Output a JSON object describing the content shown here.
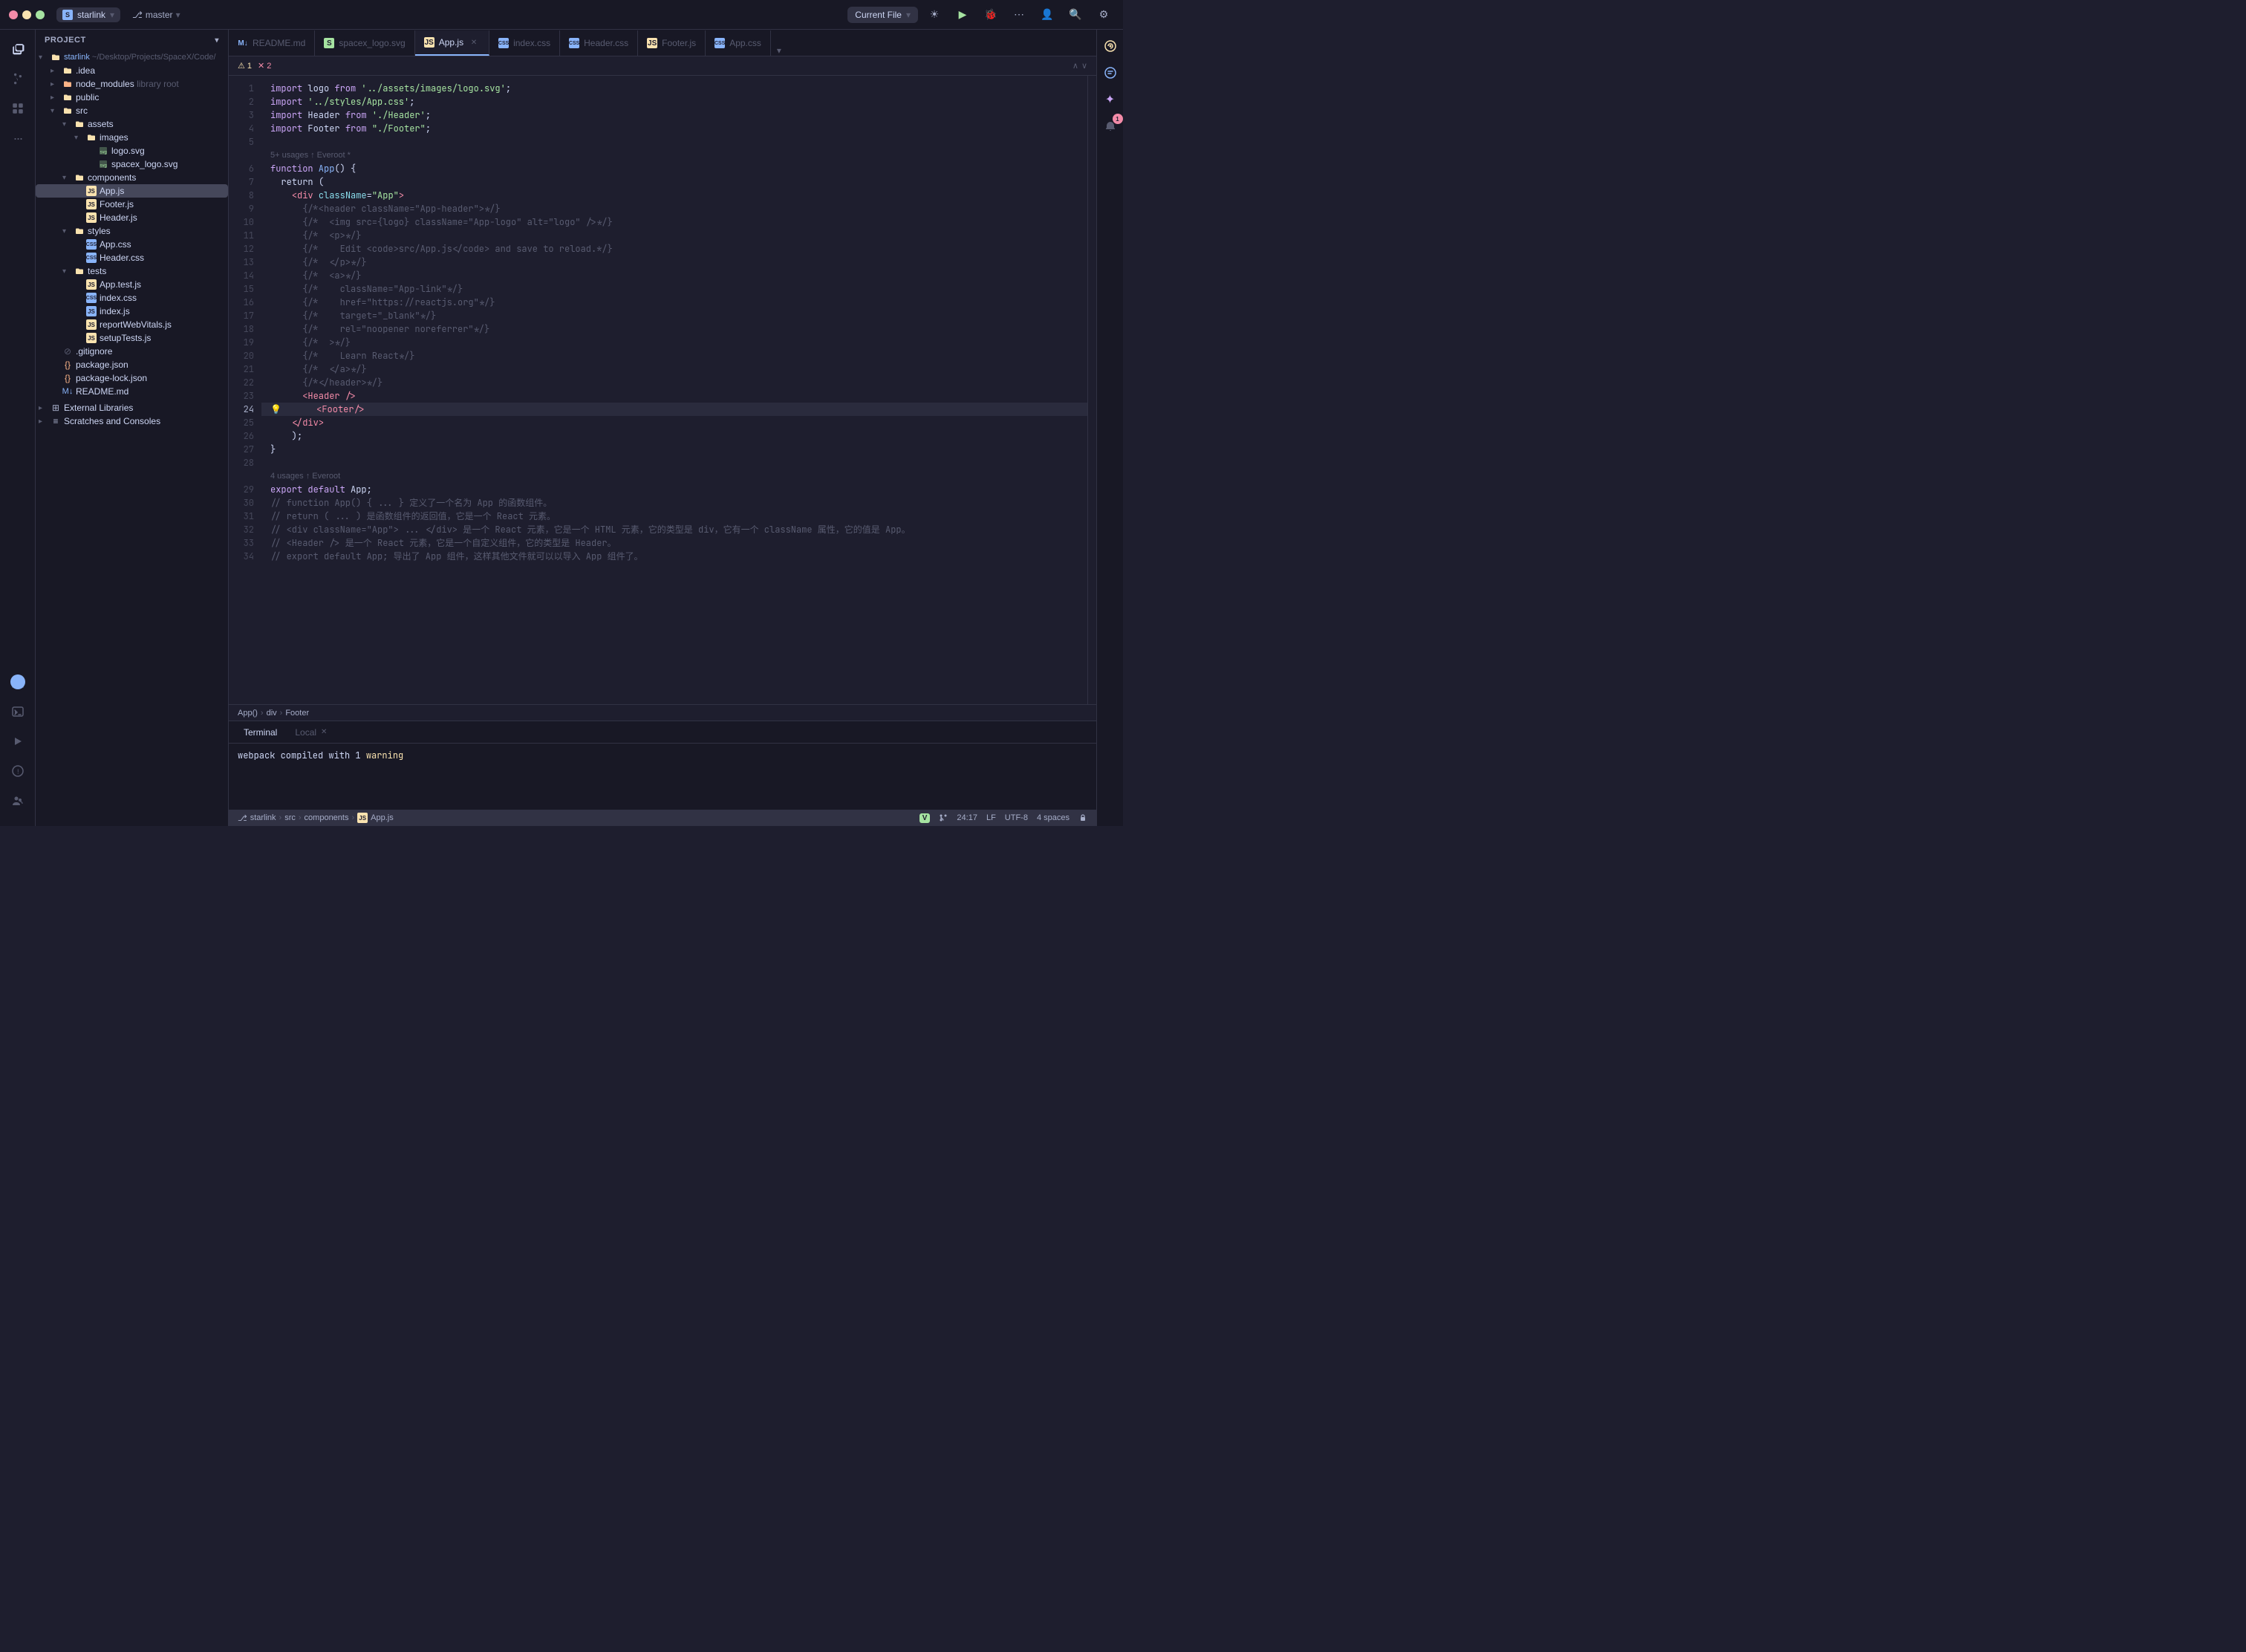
{
  "titlebar": {
    "project_icon": "S",
    "project_name": "starlink",
    "branch_icon": "⎇",
    "branch_name": "master",
    "current_file_label": "Current File",
    "run_icon": "▶",
    "debug_icon": "🐞",
    "more_icon": "⋯",
    "account_icon": "👤",
    "search_icon": "🔍",
    "settings_icon": "⚙"
  },
  "activity_bar": {
    "icons": [
      {
        "name": "files-icon",
        "glyph": "📄",
        "active": true
      },
      {
        "name": "git-icon",
        "glyph": "⎇",
        "active": false
      },
      {
        "name": "extensions-icon",
        "glyph": "⊞",
        "active": false
      },
      {
        "name": "more-icon",
        "glyph": "···",
        "active": false
      }
    ],
    "bottom_icons": [
      {
        "name": "avatar-icon",
        "glyph": "👤"
      },
      {
        "name": "terminal-icon",
        "glyph": "⬜"
      },
      {
        "name": "run-icon",
        "glyph": "▷"
      },
      {
        "name": "problems-icon",
        "glyph": "⚠"
      },
      {
        "name": "collab-icon",
        "glyph": "👥"
      }
    ]
  },
  "sidebar": {
    "header": "Project",
    "tree": [
      {
        "id": "starlink-root",
        "label": "starlink ~/Desktop/Projects/SpaceX/Code/",
        "type": "root",
        "expanded": true,
        "depth": 0
      },
      {
        "id": "idea",
        "label": ".idea",
        "type": "folder",
        "expanded": false,
        "depth": 1
      },
      {
        "id": "node_modules",
        "label": "node_modules",
        "sublabel": "library root",
        "type": "folder-special",
        "expanded": false,
        "depth": 1
      },
      {
        "id": "public",
        "label": "public",
        "type": "folder",
        "expanded": false,
        "depth": 1
      },
      {
        "id": "src",
        "label": "src",
        "type": "folder",
        "expanded": true,
        "depth": 1
      },
      {
        "id": "assets",
        "label": "assets",
        "type": "folder",
        "expanded": true,
        "depth": 2
      },
      {
        "id": "images",
        "label": "images",
        "type": "folder",
        "expanded": true,
        "depth": 3
      },
      {
        "id": "logo-svg",
        "label": "logo.svg",
        "type": "svg",
        "depth": 4
      },
      {
        "id": "spacex-svg",
        "label": "spacex_logo.svg",
        "type": "svg",
        "depth": 4
      },
      {
        "id": "components",
        "label": "components",
        "type": "folder",
        "expanded": true,
        "depth": 2
      },
      {
        "id": "app-js",
        "label": "App.js",
        "type": "js",
        "depth": 3,
        "active": true
      },
      {
        "id": "footer-js",
        "label": "Footer.js",
        "type": "js",
        "depth": 3
      },
      {
        "id": "header-js",
        "label": "Header.js",
        "type": "js",
        "depth": 3
      },
      {
        "id": "styles",
        "label": "styles",
        "type": "folder",
        "expanded": true,
        "depth": 2
      },
      {
        "id": "app-css",
        "label": "App.css",
        "type": "css",
        "depth": 3
      },
      {
        "id": "header-css",
        "label": "Header.css",
        "type": "css",
        "depth": 3
      },
      {
        "id": "tests",
        "label": "tests",
        "type": "folder",
        "expanded": true,
        "depth": 2
      },
      {
        "id": "app-test",
        "label": "App.test.js",
        "type": "test",
        "depth": 3
      },
      {
        "id": "index-css",
        "label": "index.css",
        "type": "css",
        "depth": 3
      },
      {
        "id": "index-js",
        "label": "index.js",
        "type": "js",
        "depth": 3
      },
      {
        "id": "reportweb",
        "label": "reportWebVitals.js",
        "type": "js",
        "depth": 3
      },
      {
        "id": "setuptests",
        "label": "setupTests.js",
        "type": "js",
        "depth": 3
      },
      {
        "id": "gitignore",
        "label": ".gitignore",
        "type": "git",
        "depth": 1
      },
      {
        "id": "package-json",
        "label": "package.json",
        "type": "json",
        "depth": 1
      },
      {
        "id": "package-lock",
        "label": "package-lock.json",
        "type": "json",
        "depth": 1
      },
      {
        "id": "readme",
        "label": "README.md",
        "type": "md",
        "depth": 1
      },
      {
        "id": "ext-libs",
        "label": "External Libraries",
        "type": "folder",
        "expanded": false,
        "depth": 0
      },
      {
        "id": "scratches",
        "label": "Scratches and Consoles",
        "type": "folder",
        "expanded": false,
        "depth": 0
      }
    ]
  },
  "tabs": [
    {
      "id": "readme-tab",
      "label": "README.md",
      "type": "md",
      "active": false
    },
    {
      "id": "spacex-svg-tab",
      "label": "spacex_logo.svg",
      "type": "svg",
      "active": false
    },
    {
      "id": "app-js-tab",
      "label": "App.js",
      "type": "js",
      "active": true,
      "modified": false
    },
    {
      "id": "index-css-tab",
      "label": "index.css",
      "type": "css",
      "active": false
    },
    {
      "id": "header-css-tab",
      "label": "Header.css",
      "type": "css",
      "active": false
    },
    {
      "id": "footer-js-tab",
      "label": "Footer.js",
      "type": "js",
      "active": false
    },
    {
      "id": "app-css-tab",
      "label": "App.css",
      "type": "css",
      "active": false
    }
  ],
  "editor": {
    "warnings": 1,
    "errors": 2,
    "filename": "App.js",
    "code_lines": [
      {
        "num": 1,
        "tokens": [
          {
            "t": "kw",
            "v": "import"
          },
          {
            "t": "var",
            "v": " logo "
          },
          {
            "t": "kw",
            "v": "from"
          },
          {
            "t": "str",
            "v": " '../assets/images/logo.svg'"
          },
          {
            "t": "punct",
            "v": ";"
          }
        ]
      },
      {
        "num": 2,
        "tokens": [
          {
            "t": "kw",
            "v": "import"
          },
          {
            "t": "str",
            "v": " '../styles/App.css'"
          },
          {
            "t": "punct",
            "v": ";"
          }
        ]
      },
      {
        "num": 3,
        "tokens": [
          {
            "t": "kw",
            "v": "import"
          },
          {
            "t": "var",
            "v": " Header "
          },
          {
            "t": "kw",
            "v": "from"
          },
          {
            "t": "str",
            "v": " './Header'"
          },
          {
            "t": "punct",
            "v": ";"
          }
        ]
      },
      {
        "num": 4,
        "tokens": [
          {
            "t": "kw",
            "v": "import"
          },
          {
            "t": "var",
            "v": " Footer "
          },
          {
            "t": "kw",
            "v": "from"
          },
          {
            "t": "str",
            "v": " \"./Footer\""
          },
          {
            "t": "punct",
            "v": ";"
          }
        ]
      },
      {
        "num": 5,
        "tokens": []
      },
      {
        "num": "hint1",
        "hint": "5+ usages  ↑ Everoot *"
      },
      {
        "num": 6,
        "tokens": [
          {
            "t": "kw",
            "v": "function"
          },
          {
            "t": "fn",
            "v": " App"
          },
          {
            "t": "punct",
            "v": "() {"
          }
        ]
      },
      {
        "num": 7,
        "tokens": [
          {
            "t": "var",
            "v": "  return "
          },
          {
            "t": "punct",
            "v": "("
          }
        ]
      },
      {
        "num": 8,
        "tokens": [
          {
            "t": "var",
            "v": "    "
          },
          {
            "t": "tag",
            "v": "<div"
          },
          {
            "t": "attr",
            "v": " className"
          },
          {
            "t": "punct",
            "v": "="
          },
          {
            "t": "str",
            "v": "\"App\""
          },
          {
            "t": "tag",
            "v": ">"
          }
        ]
      },
      {
        "num": 9,
        "tokens": [
          {
            "t": "cm",
            "v": "      {/*<header className=\"App-header\">*/}"
          }
        ]
      },
      {
        "num": 10,
        "tokens": [
          {
            "t": "cm",
            "v": "      {/*  <img src={logo} className=\"App-logo\" alt=\"logo\" />*/}"
          }
        ]
      },
      {
        "num": 11,
        "tokens": [
          {
            "t": "cm",
            "v": "      {/*  <p>*/}"
          }
        ]
      },
      {
        "num": 12,
        "tokens": [
          {
            "t": "cm",
            "v": "      {/*    Edit <code>src/App.js</code> and save to reload.*/}"
          }
        ]
      },
      {
        "num": 13,
        "tokens": [
          {
            "t": "cm",
            "v": "      {/*  </p>*/}"
          }
        ]
      },
      {
        "num": 14,
        "tokens": [
          {
            "t": "cm",
            "v": "      {/*  <a>*/}"
          }
        ]
      },
      {
        "num": 15,
        "tokens": [
          {
            "t": "cm",
            "v": "      {/*    className=\"App-link\"*/}"
          }
        ]
      },
      {
        "num": 16,
        "tokens": [
          {
            "t": "cm",
            "v": "      {/*    href=\"https://reactjs.org\"*/}"
          }
        ]
      },
      {
        "num": 17,
        "tokens": [
          {
            "t": "cm",
            "v": "      {/*    target=\"_blank\"*/}"
          }
        ]
      },
      {
        "num": 18,
        "tokens": [
          {
            "t": "cm",
            "v": "      {/*    rel=\"noopener noreferrer\"*/}"
          }
        ]
      },
      {
        "num": 19,
        "tokens": [
          {
            "t": "cm",
            "v": "      {/*  >*/}"
          }
        ]
      },
      {
        "num": 20,
        "tokens": [
          {
            "t": "cm",
            "v": "      {/*    Learn React*/}"
          }
        ]
      },
      {
        "num": 21,
        "tokens": [
          {
            "t": "cm",
            "v": "      {/*  </a>*/}"
          }
        ]
      },
      {
        "num": 22,
        "tokens": [
          {
            "t": "cm",
            "v": "      {/*</header>*/}"
          }
        ]
      },
      {
        "num": 23,
        "tokens": [
          {
            "t": "var",
            "v": "      "
          },
          {
            "t": "tag",
            "v": "<Header"
          },
          {
            "t": "var",
            "v": " "
          },
          {
            "t": "tag",
            "v": "/>"
          }
        ]
      },
      {
        "num": 24,
        "tokens": [
          {
            "t": "var",
            "v": "      "
          },
          {
            "t": "tag",
            "v": "<Footer"
          },
          {
            "t": "tag",
            "v": "/>"
          }
        ],
        "active": true,
        "bulb": true
      },
      {
        "num": 25,
        "tokens": [
          {
            "t": "var",
            "v": "    "
          },
          {
            "t": "tag",
            "v": "</div>"
          }
        ]
      },
      {
        "num": 26,
        "tokens": [
          {
            "t": "var",
            "v": "  "
          },
          {
            "t": "punct",
            "v": "  );"
          }
        ]
      },
      {
        "num": 27,
        "tokens": [
          {
            "t": "punct",
            "v": "}"
          }
        ]
      },
      {
        "num": 28,
        "tokens": []
      },
      {
        "num": "hint2",
        "hint": "4 usages  ↑ Everoot"
      },
      {
        "num": 29,
        "tokens": [
          {
            "t": "kw",
            "v": "export"
          },
          {
            "t": "kw",
            "v": " default"
          },
          {
            "t": "var",
            "v": " App"
          },
          {
            "t": "punct",
            "v": ";"
          }
        ]
      },
      {
        "num": 30,
        "tokens": [
          {
            "t": "cm",
            "v": "// function App() { ... } 定义了一个名为 App 的函数组件。"
          }
        ]
      },
      {
        "num": 31,
        "tokens": [
          {
            "t": "cm",
            "v": "// return ( ... ) 是函数组件的返回值，它是一个 React 元素。"
          }
        ]
      },
      {
        "num": 32,
        "tokens": [
          {
            "t": "cm",
            "v": "// <div className=\"App\"> ... </div> 是一个 React 元素，它是一个 HTML 元素，它的类型是 div，它有一个 className 属性，它的值是 App。"
          }
        ]
      },
      {
        "num": 33,
        "tokens": [
          {
            "t": "cm",
            "v": "// <Header /> 是一个 React 元素，它是一个自定义组件，它的类型是 Header。"
          }
        ]
      },
      {
        "num": 34,
        "tokens": [
          {
            "t": "cm",
            "v": "// export default App; 导出了 App 组件，这样其他文件就可以以导入 App 组件了。"
          }
        ]
      }
    ]
  },
  "breadcrumb": {
    "path": [
      "App()",
      "div",
      "Footer"
    ]
  },
  "bottom_panel": {
    "tabs": [
      {
        "id": "terminal-tab",
        "label": "Terminal"
      },
      {
        "id": "local-tab",
        "label": "Local",
        "closeable": true
      }
    ],
    "terminal_output": "webpack compiled with 1 warning",
    "warning_word": "warning",
    "warning_count": "1"
  },
  "status_bar": {
    "project": "starlink",
    "src_path": "src",
    "components_path": "components",
    "file": "App.js",
    "vim_mode": "V",
    "git_icon": "⎇",
    "position": "24:17",
    "line_ending": "LF",
    "encoding": "UTF-8",
    "indent": "4 spaces",
    "lock_icon": "🔒"
  },
  "right_bar": {
    "icons": [
      {
        "name": "copilot-icon",
        "glyph": "✦",
        "active": true
      },
      {
        "name": "ai-icon",
        "glyph": "◎"
      },
      {
        "name": "chat-icon",
        "glyph": "💬"
      },
      {
        "name": "collab-icon",
        "glyph": "👥"
      }
    ]
  }
}
